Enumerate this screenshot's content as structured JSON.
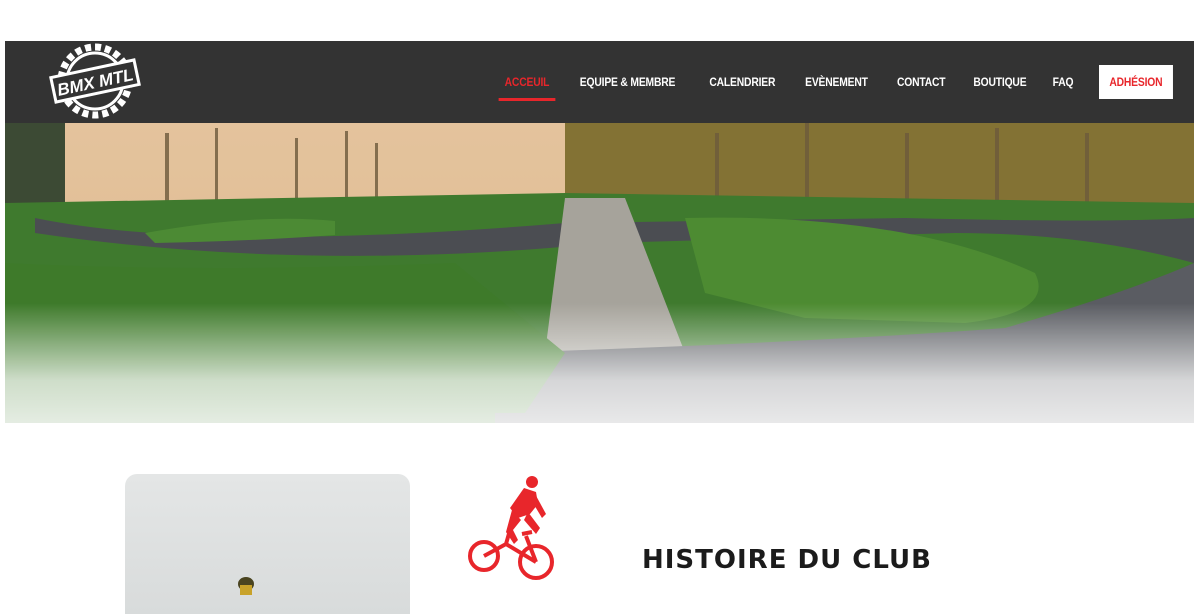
{
  "brand": {
    "logo_text": "BMX MTL"
  },
  "nav": {
    "items": [
      {
        "label": "ACCEUIL",
        "active": true
      },
      {
        "label": "EQUIPE & MEMBRE"
      },
      {
        "label": "CALENDRIER"
      },
      {
        "label": "EVÈNEMENT"
      },
      {
        "label": "CONTACT"
      },
      {
        "label": "BOUTIQUE"
      },
      {
        "label": "FAQ"
      }
    ],
    "cta_label": "ADHÉSION"
  },
  "hero": {
    "image": "bmx-track-panorama"
  },
  "section": {
    "title": "HISTOIRE DU CLUB"
  },
  "colors": {
    "accent": "#e8262b",
    "header_bg": "#333333"
  }
}
